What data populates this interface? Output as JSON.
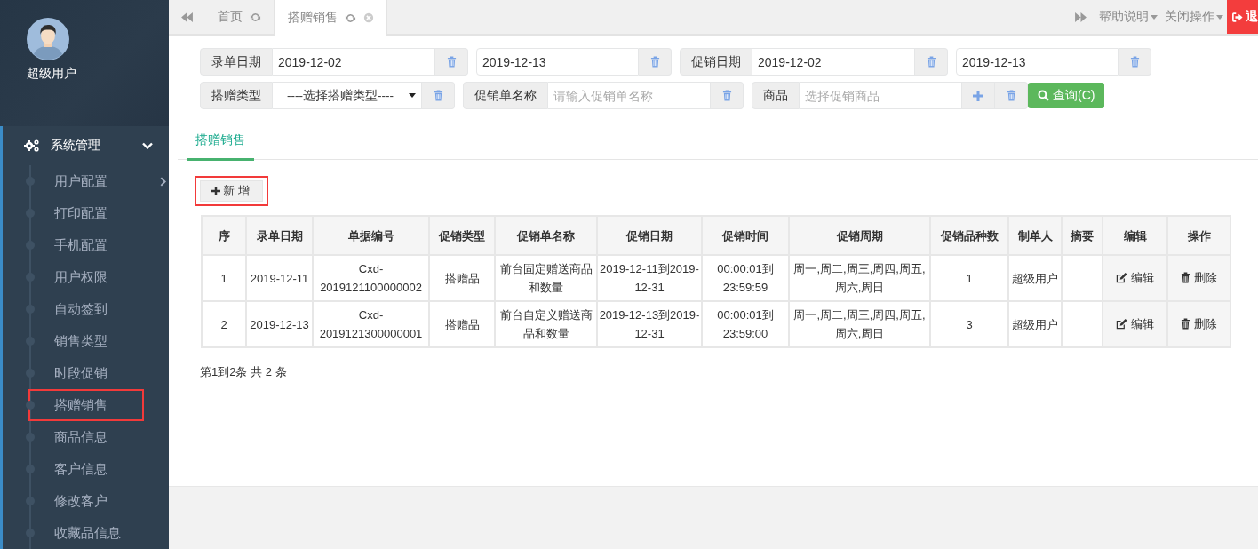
{
  "sidebar": {
    "user_name": "超级用户",
    "menu": {
      "label": "系统管理",
      "expanded": true,
      "items": [
        {
          "label": "用户配置",
          "has_submenu": true,
          "highlighted": false
        },
        {
          "label": "打印配置",
          "has_submenu": false,
          "highlighted": false
        },
        {
          "label": "手机配置",
          "has_submenu": false,
          "highlighted": false
        },
        {
          "label": "用户权限",
          "has_submenu": false,
          "highlighted": false
        },
        {
          "label": "自动签到",
          "has_submenu": false,
          "highlighted": false
        },
        {
          "label": "销售类型",
          "has_submenu": false,
          "highlighted": false
        },
        {
          "label": "时段促销",
          "has_submenu": false,
          "highlighted": false
        },
        {
          "label": "搭赠销售",
          "has_submenu": false,
          "highlighted": true
        },
        {
          "label": "商品信息",
          "has_submenu": false,
          "highlighted": false
        },
        {
          "label": "客户信息",
          "has_submenu": false,
          "highlighted": false
        },
        {
          "label": "修改客户",
          "has_submenu": false,
          "highlighted": false
        },
        {
          "label": "收藏品信息",
          "has_submenu": false,
          "highlighted": false
        }
      ]
    }
  },
  "page_tabs": [
    {
      "label": "首页",
      "selected": false,
      "closable": false
    },
    {
      "label": "搭赠销售",
      "selected": true,
      "closable": true
    }
  ],
  "top_actions": [
    {
      "label": "帮助说明",
      "kind": "dropdown"
    },
    {
      "label": "关闭操作",
      "kind": "dropdown"
    },
    {
      "label": "退",
      "kind": "logout"
    }
  ],
  "filters": [
    [
      {
        "kind": "date",
        "label": "录单日期",
        "value": "2019-12-02"
      },
      {
        "kind": "date",
        "value": "2019-12-13"
      },
      {
        "kind": "date",
        "label": "促销日期",
        "value": "2019-12-02"
      },
      {
        "kind": "date",
        "value": "2019-12-13"
      }
    ],
    [
      {
        "kind": "select",
        "label": "搭赠类型",
        "value": "----选择搭赠类型----"
      },
      {
        "kind": "text",
        "label": "促销单名称",
        "placeholder": "请输入促销单名称"
      },
      {
        "kind": "text",
        "label": "商品",
        "placeholder": "选择促销商品",
        "addable": true
      }
    ]
  ],
  "search_button": "查询(C)",
  "content_tabs": [
    {
      "label": "搭赠销售",
      "selected": true
    }
  ],
  "add_button": {
    "label": "新 增",
    "highlighted": true
  },
  "table": {
    "columns": [
      "序",
      "录单日期",
      "单据编号",
      "促销类型",
      "促销单名称",
      "促销日期",
      "促销时间",
      "促销周期",
      "促销品种数",
      "制单人",
      "摘要",
      "编辑",
      "操作"
    ],
    "rows": [
      {
        "cells": [
          "1",
          "2019-12-11",
          "Cxd-2019121100000002",
          "搭赠品",
          "前台固定赠送商品和数量",
          "2019-12-11到2019-12-31",
          "00:00:01到23:59:59",
          "周一,周二,周三,周四,周五,周六,周日",
          "1",
          "超级用户"
        ],
        "edit": "编辑",
        "delete": "删除"
      },
      {
        "cells": [
          "2",
          "2019-12-13",
          "Cxd-2019121300000001",
          "搭赠品",
          "前台自定义赠送商品和数量",
          "2019-12-13到2019-12-31",
          "00:00:01到23:59:00",
          "周一,周二,周三,周四,周五,周六,周日",
          "3",
          "超级用户"
        ],
        "edit": "编辑",
        "delete": "删除"
      }
    ]
  },
  "pagination": "第1到2条 共 2 条"
}
